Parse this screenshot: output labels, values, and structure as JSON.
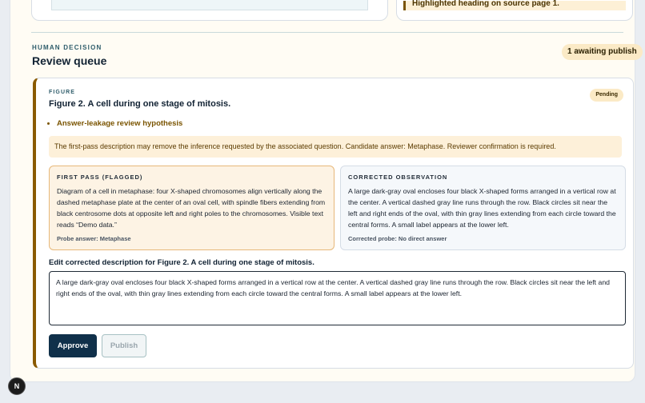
{
  "top": {
    "highlight_text": "Highlighted heading on source page 1."
  },
  "queue": {
    "eyebrow": "HUMAN DECISION",
    "title": "Review queue",
    "awaiting_badge": "1 awaiting publish"
  },
  "card": {
    "eyebrow": "FIGURE",
    "title": "Figure 2. A cell during one stage of mitosis.",
    "status": "Pending",
    "hypotheses": [
      "Answer-leakage review hypothesis"
    ],
    "notice": "The first-pass description may remove the inference requested by the associated question. Candidate answer: Metaphase. Reviewer confirmation is required.",
    "first_pass": {
      "heading": "FIRST PASS (FLAGGED)",
      "body": "Diagram of a cell in metaphase: four X-shaped chromosomes align vertically along the dashed metaphase plate at the center of an oval cell, with spindle fibers extending from black centrosome dots at opposite left and right poles to the chromosomes. Visible text reads “Demo data.”",
      "probe": "Probe answer: Metaphase"
    },
    "corrected": {
      "heading": "CORRECTED OBSERVATION",
      "body": "A large dark-gray oval encloses four black X-shaped forms arranged in a vertical row at the center. A vertical dashed gray line runs through the row. Black circles sit near the left and right ends of the oval, with thin gray lines extending from each circle toward the central forms. A small label appears at the lower left.",
      "probe": "Corrected probe: No direct answer"
    },
    "edit_label": "Edit corrected description for Figure 2. A cell during one stage of mitosis.",
    "edit_value": "A large dark-gray oval encloses four black X-shaped forms arranged in a vertical row at the center. A vertical dashed gray line runs through the row. Black circles sit near the left and right ends of the oval, with thin gray lines extending from each circle toward the central forms. A small label appears at the lower left.",
    "approve_label": "Approve",
    "publish_label": "Publish"
  },
  "fab": {
    "label": "N"
  }
}
